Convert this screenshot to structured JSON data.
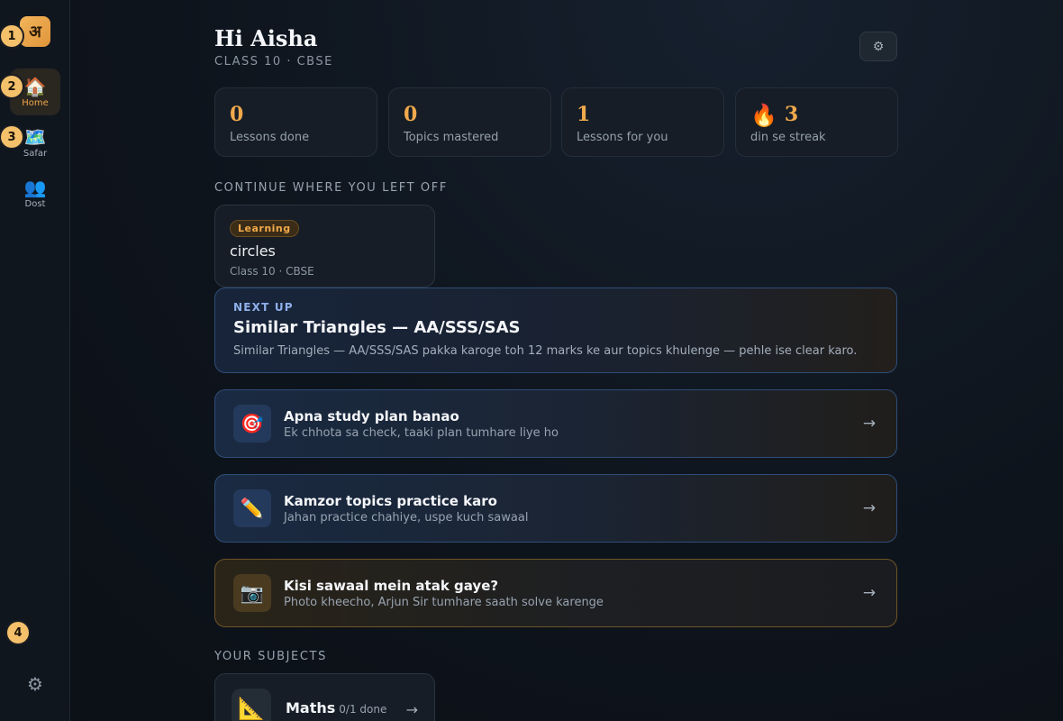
{
  "sidebar": {
    "logo": "अ",
    "items": [
      {
        "label": "Home",
        "icon": "🏠"
      },
      {
        "label": "Safar",
        "icon": "🗺️"
      },
      {
        "label": "Dost",
        "icon": "👥"
      }
    ],
    "settings_icon": "⚙",
    "markers": [
      "1",
      "2",
      "3",
      "4"
    ]
  },
  "header": {
    "greeting": "Hi Aisha",
    "subline": "CLASS 10 · CBSE",
    "settings_icon": "⚙"
  },
  "stats": [
    {
      "value": "0",
      "label": "Lessons done"
    },
    {
      "value": "0",
      "label": "Topics mastered"
    },
    {
      "value": "1",
      "label": "Lessons for you"
    },
    {
      "icon": "🔥",
      "value": "3",
      "label": "din se streak"
    }
  ],
  "continue": {
    "heading": "CONTINUE WHERE YOU LEFT OFF",
    "badge": "Learning",
    "title": "circles",
    "sub": "Class 10 · CBSE"
  },
  "next_up": {
    "label": "NEXT UP",
    "title": "Similar Triangles — AA/SSS/SAS",
    "desc": "Similar Triangles — AA/SSS/SAS pakka karoge toh 12 marks ke aur topics khulenge — pehle ise clear karo."
  },
  "actions": [
    {
      "icon": "🎯",
      "title": "Apna study plan banao",
      "sub": "Ek chhota sa check, taaki plan tumhare liye ho",
      "arrow": "→"
    },
    {
      "icon": "✏️",
      "title": "Kamzor topics practice karo",
      "sub": "Jahan practice chahiye, uspe kuch sawaal",
      "arrow": "→"
    },
    {
      "icon": "📷",
      "title": "Kisi sawaal mein atak gaye?",
      "sub": "Photo kheecho, Arjun Sir tumhare saath solve karenge",
      "arrow": "→"
    }
  ],
  "subjects": {
    "heading": "YOUR SUBJECTS",
    "items": [
      {
        "icon": "📐",
        "name": "Maths",
        "progress": "0/1 done",
        "arrow": "→"
      }
    ]
  },
  "colors": {
    "accent": "#f0a94c",
    "blue_border": "#2f4d78",
    "amber_border": "#6e5428"
  }
}
